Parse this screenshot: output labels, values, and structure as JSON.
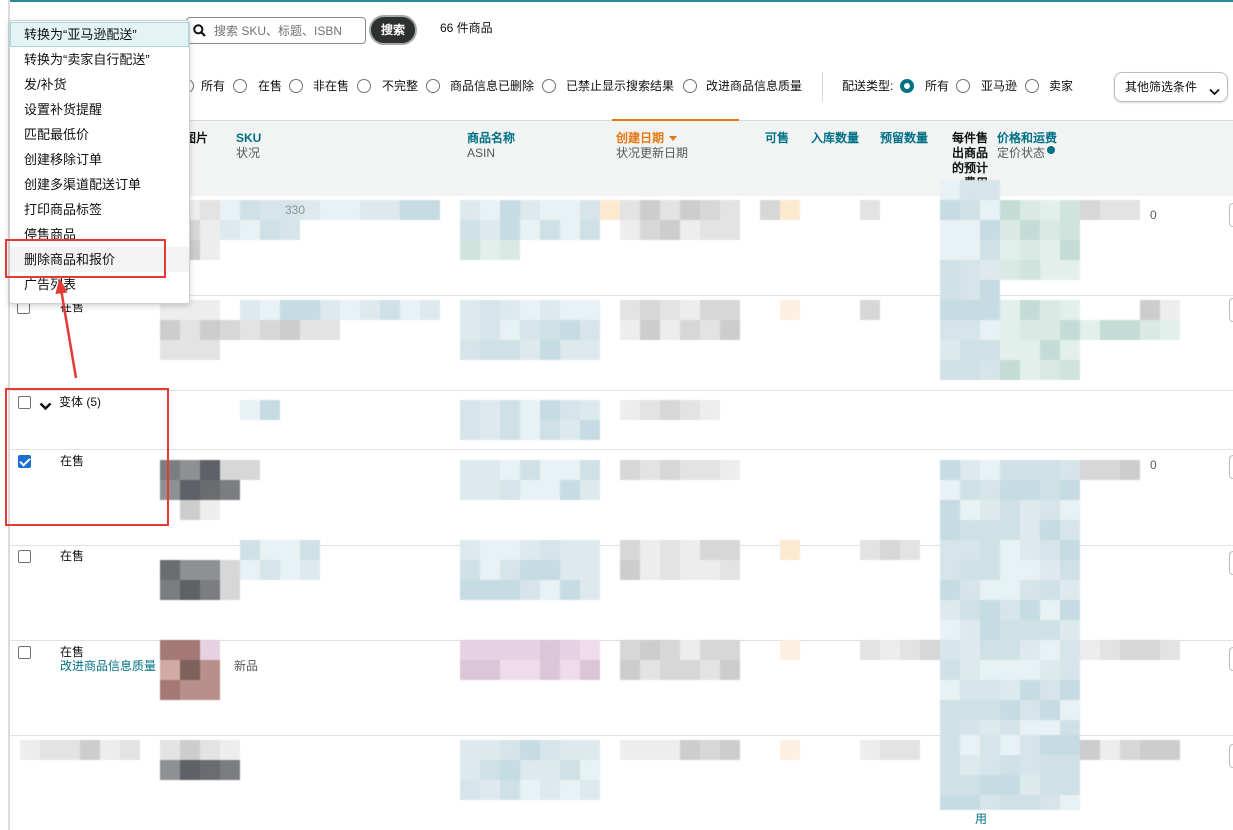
{
  "search": {
    "placeholder": "搜索 SKU、标题、ISBN",
    "button_label": "搜索",
    "result_count": "66 件商品"
  },
  "bulk_actions_menu": {
    "items": [
      "转换为“亚马逊配送”",
      "转换为“卖家自行配送”",
      "发/补货",
      "设置补货提醒",
      "匹配最低价",
      "创建移除订单",
      "创建多渠道配送订单",
      "打印商品标签",
      "停售商品",
      "删除商品和报价",
      "广告列表"
    ],
    "focused_index": 0,
    "highlighted_index": 9
  },
  "filters": {
    "status_options": [
      "所有",
      "在售",
      "非在售",
      "不完整",
      "商品信息已删除",
      "已禁止显示搜索结果",
      "改进商品信息质量"
    ],
    "fulfillment_label": "配送类型:",
    "fulfillment_options": [
      "所有",
      "亚马逊",
      "卖家"
    ],
    "fulfillment_selected_index": 0,
    "more_filters_label": "其他筛选条件"
  },
  "table": {
    "columns": {
      "image": "图片",
      "sku": "SKU",
      "sku_sub": "状况",
      "name": "商品名称",
      "name_sub": "ASIN",
      "date": "创建日期",
      "date_sub": "状况更新日期",
      "available": "可售",
      "inbound": "入库数量",
      "reserved": "预留数量",
      "fees": "每件售出商品的预计费用",
      "price": "价格和运费",
      "price_sub": "定价状态"
    },
    "rows": [
      {
        "sku_fragment": "330",
        "price_fragment": "0"
      },
      {
        "status": "在售",
        "checked": false
      },
      {
        "variant_label": "变体 (5)",
        "checked": false,
        "expanded": true
      },
      {
        "status": "在售",
        "checked": true,
        "price_fragment": "0"
      },
      {
        "status": "在售",
        "checked": false
      },
      {
        "status": "在售",
        "checked": false,
        "action_link": "改进商品信息质量",
        "condition_fragment": "新品"
      },
      {
        "fee_fragment": "用"
      }
    ]
  },
  "icons": {
    "search": "search-icon",
    "sort": "caret-down-icon",
    "variant_toggle": "chevron-down-icon",
    "more_filters": "chevron-down-icon",
    "pricing_info": "info-icon"
  },
  "colors": {
    "accent": "#007185",
    "sort_active": "#e47911",
    "annotation": "#e53935",
    "checkbox_checked": "#1b6fd1"
  }
}
